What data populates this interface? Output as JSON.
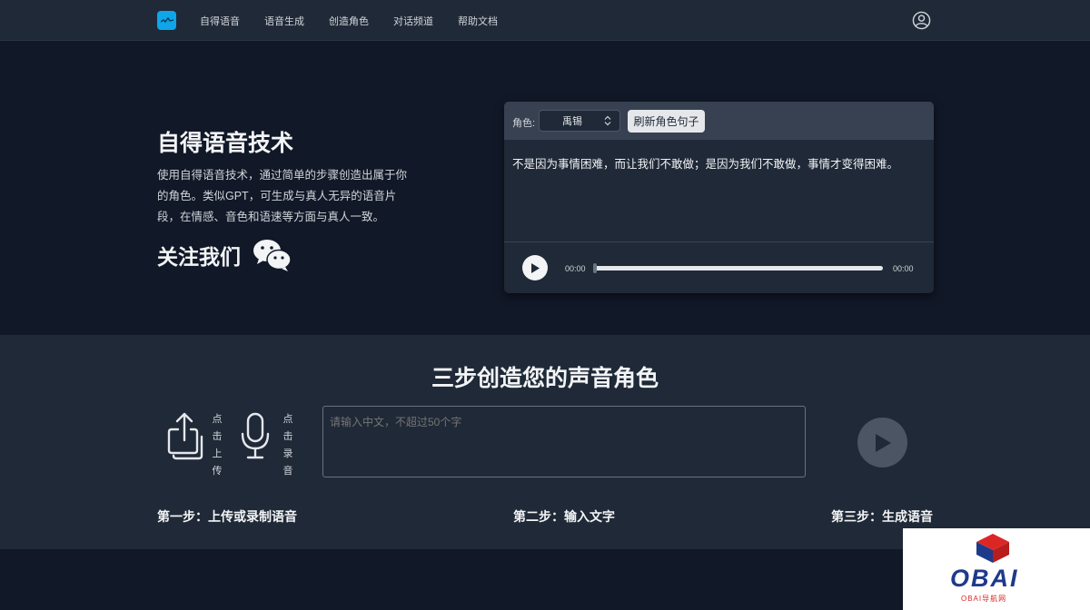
{
  "nav": {
    "links": [
      "自得语音",
      "语音生成",
      "创造角色",
      "对话频道",
      "帮助文档"
    ]
  },
  "hero": {
    "title": "自得语音技术",
    "description": "使用自得语音技术，通过简单的步骤创造出属于你的角色。类似GPT，可生成与真人无异的语音片段，在情感、音色和语速等方面与真人一致。",
    "follow": "关注我们"
  },
  "demo": {
    "role_label": "角色:",
    "role_value": "禹锡",
    "refresh_label": "刷新角色句子",
    "sentence": "不是因为事情困难，而让我们不敢做；是因为我们不敢做，事情才变得困难。",
    "time_start": "00:00",
    "time_end": "00:00",
    "progress": 0
  },
  "steps": {
    "title": "三步创造您的声音角色",
    "upload_text": "点击上传",
    "record_text": "点击录音",
    "input_placeholder": "请输入中文，不超过50个字",
    "step1": "第一步：上传或录制语音",
    "step2": "第二步：输入文字",
    "step3": "第三步：生成语音"
  },
  "watermark": {
    "brand": "OBAI",
    "sub": "OBAI导航网"
  },
  "colors": {
    "nav_bg": "#1f2937",
    "page_bg": "#111827",
    "accent": "#0ea5e9"
  }
}
